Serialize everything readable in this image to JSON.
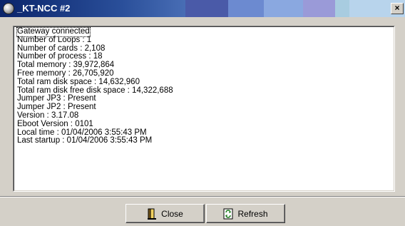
{
  "window": {
    "title": "_KT-NCC #2",
    "close_glyph": "×"
  },
  "log": {
    "lines": [
      "Gateway connected",
      "Number of Loops : 1",
      "Number of cards : 2,108",
      "Number of process : 18",
      "Total memory : 39,972,864",
      "Free memory : 26,705,920",
      "Total ram disk space : 14,632,960",
      "Total ram disk free disk space : 14,322,688",
      "Jumper JP3 : Present",
      "Jumper JP2 : Present",
      "Version : 3.17.08",
      "Eboot Version : 0101",
      "Local time : 01/04/2006 3:55:43 PM",
      "Last startup : 01/04/2006 3:55:43 PM"
    ]
  },
  "buttons": {
    "close_label": "Close",
    "refresh_label": "Refresh"
  },
  "icons": {
    "title": "app-icon",
    "close": "door-exit-icon",
    "refresh": "refresh-icon"
  }
}
